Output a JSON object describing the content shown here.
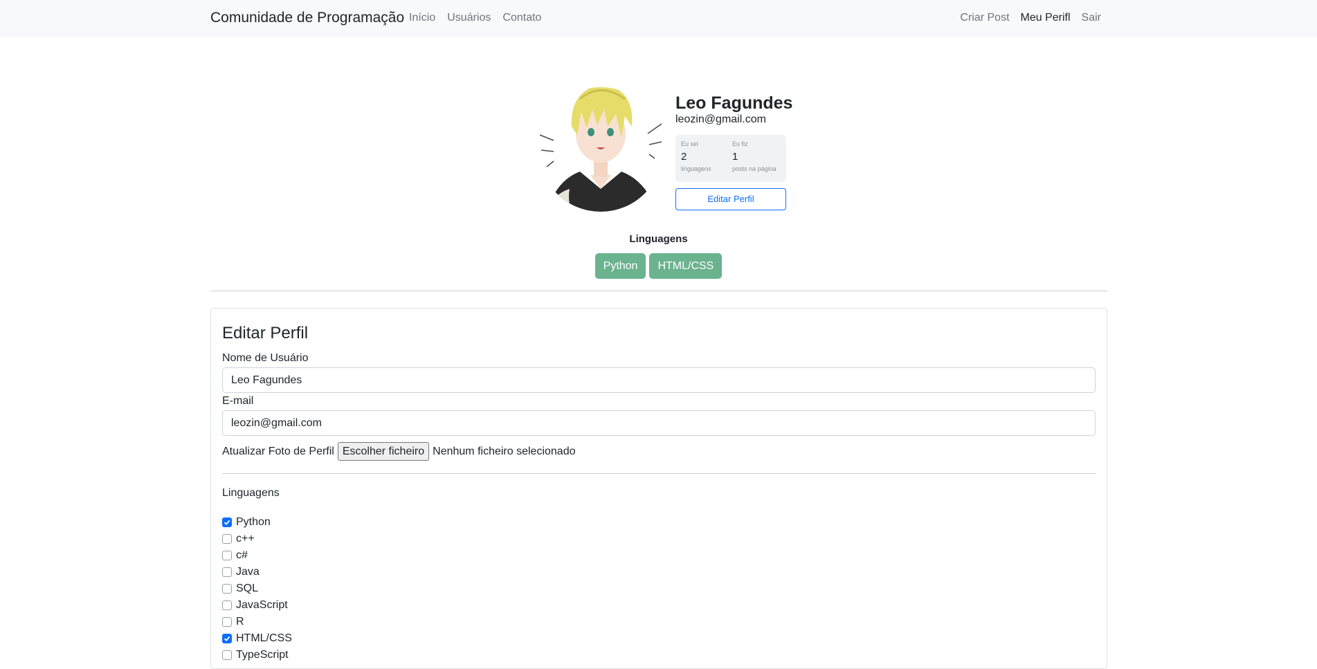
{
  "navbar": {
    "brand": "Comunidade de Programação",
    "left_links": [
      "Início",
      "Usuários",
      "Contato"
    ],
    "right_links": [
      "Criar Post",
      "Meu Perifl",
      "Sair"
    ]
  },
  "profile": {
    "name": "Leo Fagundes",
    "email": "leozin@gmail.com",
    "stats": [
      {
        "label": "Eu sei",
        "value": "2",
        "sub": "linguagens"
      },
      {
        "label": "Eu fiz",
        "value": "1",
        "sub": "posts na página"
      }
    ],
    "edit_button": "Editar Perfil",
    "languages_title": "Linguagens",
    "languages": [
      "Python",
      "HTML/CSS"
    ]
  },
  "form": {
    "title": "Editar Perfil",
    "username_label": "Nome de Usuário",
    "username_value": "Leo Fagundes",
    "email_label": "E-mail",
    "email_value": "leozin@gmail.com",
    "photo_label": "Atualizar Foto de Perfil",
    "file_button": "Escolher ficheiro",
    "file_status": "Nenhum ficheiro selecionado",
    "languages_label": "Linguagens",
    "languages": [
      {
        "label": "Python",
        "checked": true
      },
      {
        "label": "c++",
        "checked": false
      },
      {
        "label": "c#",
        "checked": false
      },
      {
        "label": "Java",
        "checked": false
      },
      {
        "label": "SQL",
        "checked": false
      },
      {
        "label": "JavaScript",
        "checked": false
      },
      {
        "label": "R",
        "checked": false
      },
      {
        "label": "HTML/CSS",
        "checked": true
      },
      {
        "label": "TypeScript",
        "checked": false
      }
    ]
  },
  "colors": {
    "accent": "#0d6efd",
    "badge": "#6bb28f",
    "navbar_bg": "#f8f9fa"
  }
}
